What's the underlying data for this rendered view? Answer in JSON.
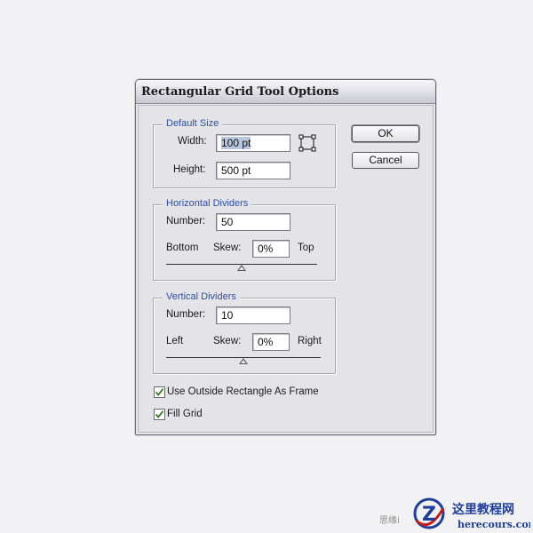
{
  "dialog": {
    "title": "Rectangular Grid Tool Options",
    "ok_label": "OK",
    "cancel_label": "Cancel"
  },
  "default_size": {
    "legend": "Default Size",
    "width_label": "Width:",
    "width_value": "100 pt",
    "height_label": "Height:",
    "height_value": "500 pt",
    "origin_icon": "reference-point-icon"
  },
  "horizontal_dividers": {
    "legend": "Horizontal Dividers",
    "number_label": "Number:",
    "number_value": "50",
    "left_end_label": "Bottom",
    "skew_label": "Skew:",
    "skew_value": "0%",
    "right_end_label": "Top",
    "skew_level": 0
  },
  "vertical_dividers": {
    "legend": "Vertical Dividers",
    "number_label": "Number:",
    "number_value": "10",
    "left_end_label": "Left",
    "skew_label": "Skew:",
    "skew_value": "0%",
    "right_end_label": "Right",
    "skew_level": 0
  },
  "options": {
    "use_outside_rect_label": "Use Outside Rectangle As Frame",
    "use_outside_rect_checked": true,
    "fill_grid_label": "Fill Grid",
    "fill_grid_checked": true
  },
  "watermark": {
    "small_text": "思缘i",
    "logo_title": "这里教程网",
    "logo_url": "herecours.com"
  },
  "colors": {
    "legend_text": "#2b4ea8",
    "logo_red": "#cc1a1a",
    "logo_blue": "#1f3e9a"
  }
}
